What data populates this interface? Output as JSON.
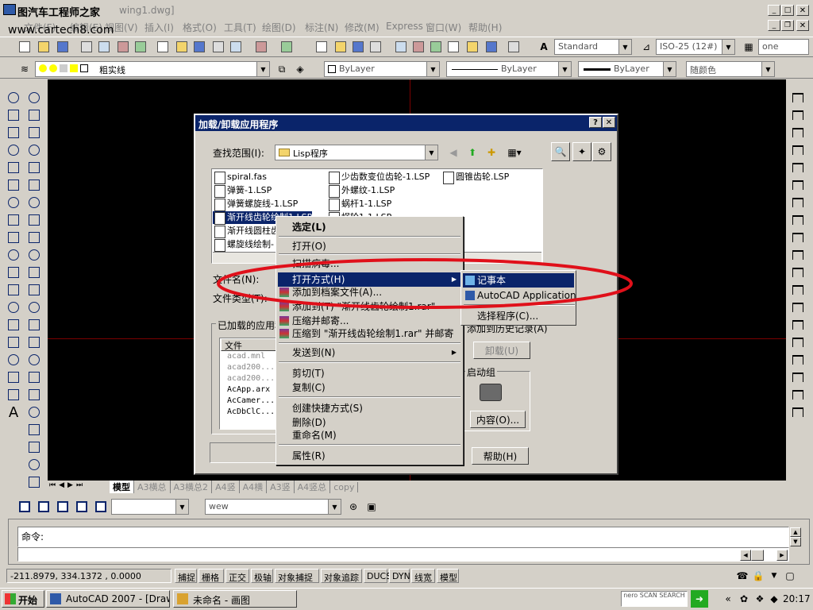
{
  "window": {
    "title": "图汽车工程师之家",
    "doc_title": "wing1.dwg]",
    "watermark": "www.cartech8.com"
  },
  "menu": [
    "文件(F)",
    "编辑(E)",
    "视图(V)",
    "插入(I)",
    "格式(O)",
    "工具(T)",
    "绘图(D)",
    "标注(N)",
    "修改(M)",
    "Express",
    "窗口(W)",
    "帮助(H)"
  ],
  "styles": {
    "text_style": "Standard",
    "dim_style": "ISO-25 (12#)",
    "table_style": "one"
  },
  "layers": {
    "layer_name": "粗实线",
    "color": "ByLayer",
    "linetype": "ByLayer",
    "lineweight": "ByLayer",
    "plotstyle": "随颜色"
  },
  "dialog": {
    "title": "加载/卸载应用程序",
    "lookin_label": "查找范围(I):",
    "lookin_value": "Lisp程序",
    "files_col1": [
      "spiral.fas",
      "弹簧-1.LSP",
      "弹簧螺旋线-1.LSP",
      "渐开线齿轮绘制1.LSP",
      "渐开线圆柱齿",
      "螺旋线绘制-"
    ],
    "files_col2": [
      "少齿数变位齿轮-1.LSP",
      "外螺纹-1.LSP",
      "蜗杆1-1.LSP",
      "蜗轮1-1.LSP"
    ],
    "files_col3": [
      "圆锥齿轮.LSP"
    ],
    "filename_label": "文件名(N):",
    "filetype_label": "文件类型(T):",
    "loaded_label": "已加载的应用程",
    "history_label": "添加到历史记录(A)",
    "table_header": "文件",
    "loaded_files": [
      "acad.mnl",
      "acad200...",
      "acad200...",
      "AcApp.arx",
      "AcCamer...",
      "AcDbClC..."
    ],
    "unload_button": "卸载(U)",
    "startup_group": "启动组",
    "contents_button": "内容(O)...",
    "help_button": "帮助(H)"
  },
  "context_menu": [
    {
      "label": "选定(L)",
      "bold": true
    },
    {
      "label": "打开(O)"
    },
    {
      "label": "扫描病毒..."
    },
    {
      "label": "打开方式(H)",
      "highlight": true,
      "submenu": true
    },
    {
      "label": "添加到档案文件(A)..."
    },
    {
      "label": "添加到(T) \"渐开线齿轮绘制1.rar\""
    },
    {
      "label": "压缩并邮寄..."
    },
    {
      "label": "压缩到 \"渐开线齿轮绘制1.rar\" 并邮寄"
    },
    {
      "label": "发送到(N)",
      "submenu": true
    },
    {
      "label": "剪切(T)"
    },
    {
      "label": "复制(C)"
    },
    {
      "label": "创建快捷方式(S)"
    },
    {
      "label": "删除(D)"
    },
    {
      "label": "重命名(M)"
    },
    {
      "label": "属性(R)"
    }
  ],
  "submenu": {
    "items": [
      "记事本",
      "AutoCAD Application",
      "选择程序(C)..."
    ]
  },
  "layout_tabs": [
    "模型",
    "A3横总",
    "A3横总2",
    "A4竖",
    "A4横",
    "A3竖",
    "A4竖总",
    "copy"
  ],
  "view_combo": "wew",
  "command": {
    "prompt": "命令:"
  },
  "status": {
    "coords": "-211.8979, 334.1372 , 0.0000",
    "buttons": [
      "捕捉",
      "栅格",
      "正交",
      "极轴",
      "对象捕捉",
      "对象追踪",
      "DUCS",
      "DYN",
      "线宽",
      "模型"
    ]
  },
  "taskbar": {
    "start": "开始",
    "tasks": [
      "AutoCAD 2007 - [Drawin...",
      "未命名 - 画图"
    ],
    "search": "nero SCAN SEARCH",
    "clock": "20:17"
  },
  "colors": {
    "title_blue": "#0a246a",
    "highlight": "#0a246a",
    "annotation_red": "#e0101a",
    "canvas": "#000000"
  }
}
